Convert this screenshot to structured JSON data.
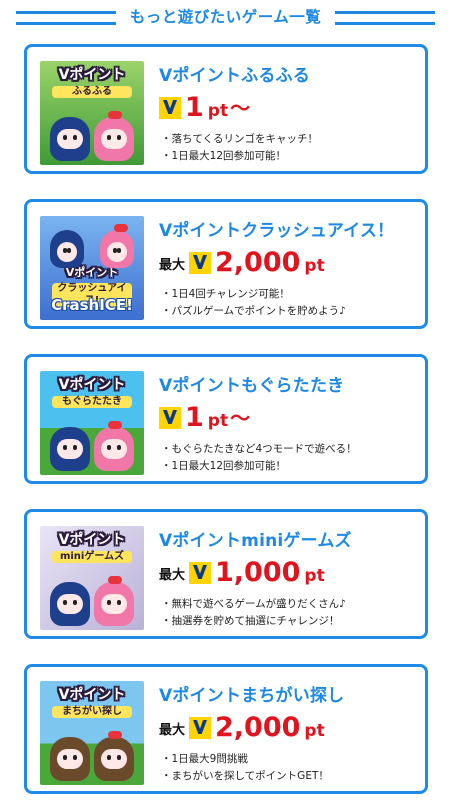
{
  "header": {
    "title": "もっと遊びたいゲーム一覧"
  },
  "games": [
    {
      "title": "Vポイントふるふる",
      "thumb_logo": "Vポイント",
      "thumb_sub": "ふるふる",
      "price_prefix": "",
      "price_value": "1",
      "price_unit": "pt",
      "price_suffix": "〜",
      "bullets": [
        "落ちてくるリンゴをキャッチ！",
        "1日最大12回参加可能！"
      ],
      "thumb_bg": "#52b043"
    },
    {
      "title": "Vポイントクラッシュアイス！",
      "thumb_logo": "Vポイント",
      "thumb_sub": "クラッシュアイス!",
      "price_prefix": "最大",
      "price_value": "2,000",
      "price_unit": "pt",
      "price_suffix": "",
      "bullets": [
        "1日4回チャレンジ可能！",
        "パズルゲームでポイントを貯めよう♪"
      ],
      "thumb_bg": "#6fa8e8",
      "thumb_extra": "CrashICE!"
    },
    {
      "title": "Vポイントもぐらたたき",
      "thumb_logo": "Vポイント",
      "thumb_sub": "もぐらたたき",
      "price_prefix": "",
      "price_value": "1",
      "price_unit": "pt",
      "price_suffix": "〜",
      "bullets": [
        "もぐらたたきなど4つモードで遊べる！",
        "1日最大12回参加可能！"
      ],
      "thumb_bg": "#3bb2e6"
    },
    {
      "title": "Vポイントminiゲームズ",
      "thumb_logo": "Vポイント",
      "thumb_sub": "miniゲームズ",
      "price_prefix": "最大",
      "price_value": "1,000",
      "price_unit": "pt",
      "price_suffix": "",
      "bullets": [
        "無料で遊べるゲームが盛りだくさん♪",
        "抽選券を貯めて抽選にチャレンジ！"
      ],
      "thumb_bg": "#d8d4ea"
    },
    {
      "title": "Vポイントまちがい探し",
      "thumb_logo": "Vポイント",
      "thumb_sub": "まちがい探し",
      "price_prefix": "最大",
      "price_value": "2,000",
      "price_unit": "pt",
      "price_suffix": "",
      "bullets": [
        "1日最大9問挑戦",
        "まちがいを探してポイントGET！"
      ],
      "thumb_bg": "#5fb6e8"
    }
  ],
  "colors": {
    "accent": "#1e88e5",
    "price": "#e0141e",
    "vmark_bg": "#ffd400",
    "vmark_fg": "#0c3a8a"
  }
}
